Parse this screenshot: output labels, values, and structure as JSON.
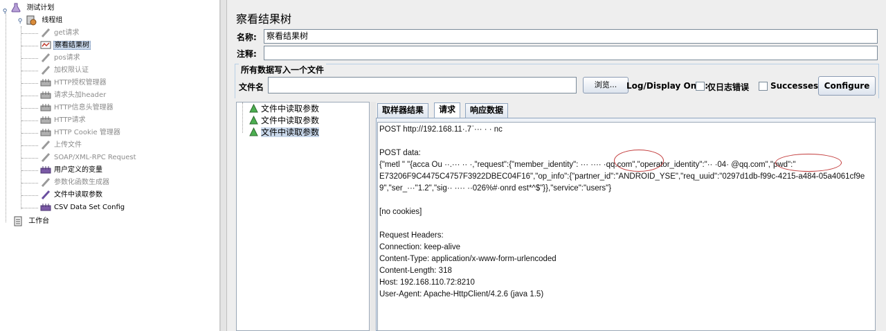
{
  "tree": {
    "root": "测试计划",
    "thread_group": "线程组",
    "items": [
      {
        "label": "get请求",
        "icon": "sampler-icon",
        "disabled": true
      },
      {
        "label": "察看结果树",
        "icon": "listener-icon",
        "disabled": false,
        "selected": true
      },
      {
        "label": "pos请求",
        "icon": "sampler-icon",
        "disabled": true
      },
      {
        "label": "加权限认证",
        "icon": "sampler-icon",
        "disabled": true
      },
      {
        "label": "HTTP授权管理器",
        "icon": "config-icon",
        "disabled": true
      },
      {
        "label": "请求头加header",
        "icon": "config-icon",
        "disabled": true
      },
      {
        "label": "HTTP信息头管理器",
        "icon": "config-icon",
        "disabled": true
      },
      {
        "label": "HTTP请求",
        "icon": "config-icon",
        "disabled": true
      },
      {
        "label": "HTTP Cookie 管理器",
        "icon": "config-icon",
        "disabled": true
      },
      {
        "label": "上传文件",
        "icon": "sampler-icon",
        "disabled": true
      },
      {
        "label": "SOAP/XML-RPC Request",
        "icon": "sampler-icon",
        "disabled": true
      },
      {
        "label": "用户定义的变量",
        "icon": "config-icon",
        "disabled": false
      },
      {
        "label": "参数化函数生成器",
        "icon": "sampler-icon",
        "disabled": true
      },
      {
        "label": "文件中读取参数",
        "icon": "sampler-active-icon",
        "disabled": false
      },
      {
        "label": "CSV Data Set Config",
        "icon": "config-icon",
        "disabled": false
      }
    ],
    "workbench": "工作台"
  },
  "panel": {
    "title": "察看结果树",
    "name_label": "名称:",
    "name_value": "察看结果树",
    "comment_label": "注释:",
    "comment_value": "",
    "file_group_title": "所有数据写入一个文件",
    "filename_label": "文件名",
    "filename_value": "",
    "browse_label": "浏览...",
    "log_display_label": "Log/Display Only:",
    "errors_only_label": "仅日志错误",
    "successes_label": "Successes",
    "configure_label": "Configure"
  },
  "results": {
    "items": [
      "文件中读取参数",
      "文件中读取参数",
      "文件中读取参数"
    ],
    "selected_index": 2
  },
  "tabs": [
    {
      "label": "取样器结果",
      "active": false
    },
    {
      "label": "请求",
      "active": true
    },
    {
      "label": "响应数据",
      "active": false
    }
  ],
  "request_text": [
    "POST http://192.168.11·.7ˈ···  · · nc",
    "",
    "POST data:",
    "{\"metl    \"  \"{acca Ou  ··.··· ·· ·,\"request\":{\"member_identity\":  ···  ···· ·qq.com\",\"operator_identity\":\"·· ·04·     @qq.com\",\"pwd\":\"",
    "E73206F9C4475C4757F3922DBEC04F16\",\"op_info\":{\"partner_id\":\"ANDROID_YSE\",\"req_uuid\":\"0297d1db-f99c-4215-a484-05a4061cf9e",
    "9\",\"ser_···\"1.2\",\"sig··   ····  ··026%#·onrd  est*^$\"}},\"service\":\"users\"}",
    "",
    "[no cookies]",
    "",
    "Request Headers:",
    "Connection: keep-alive",
    "Content-Type: application/x-www-form-urlencoded",
    "Content-Length: 318",
    "Host: 192.168.110.72:8210",
    "User-Agent: Apache-HttpClient/4.2.6 (java 1.5)"
  ],
  "colors": {
    "selection": "#c8d7ea",
    "annotation_circle": "#c23a3a"
  }
}
